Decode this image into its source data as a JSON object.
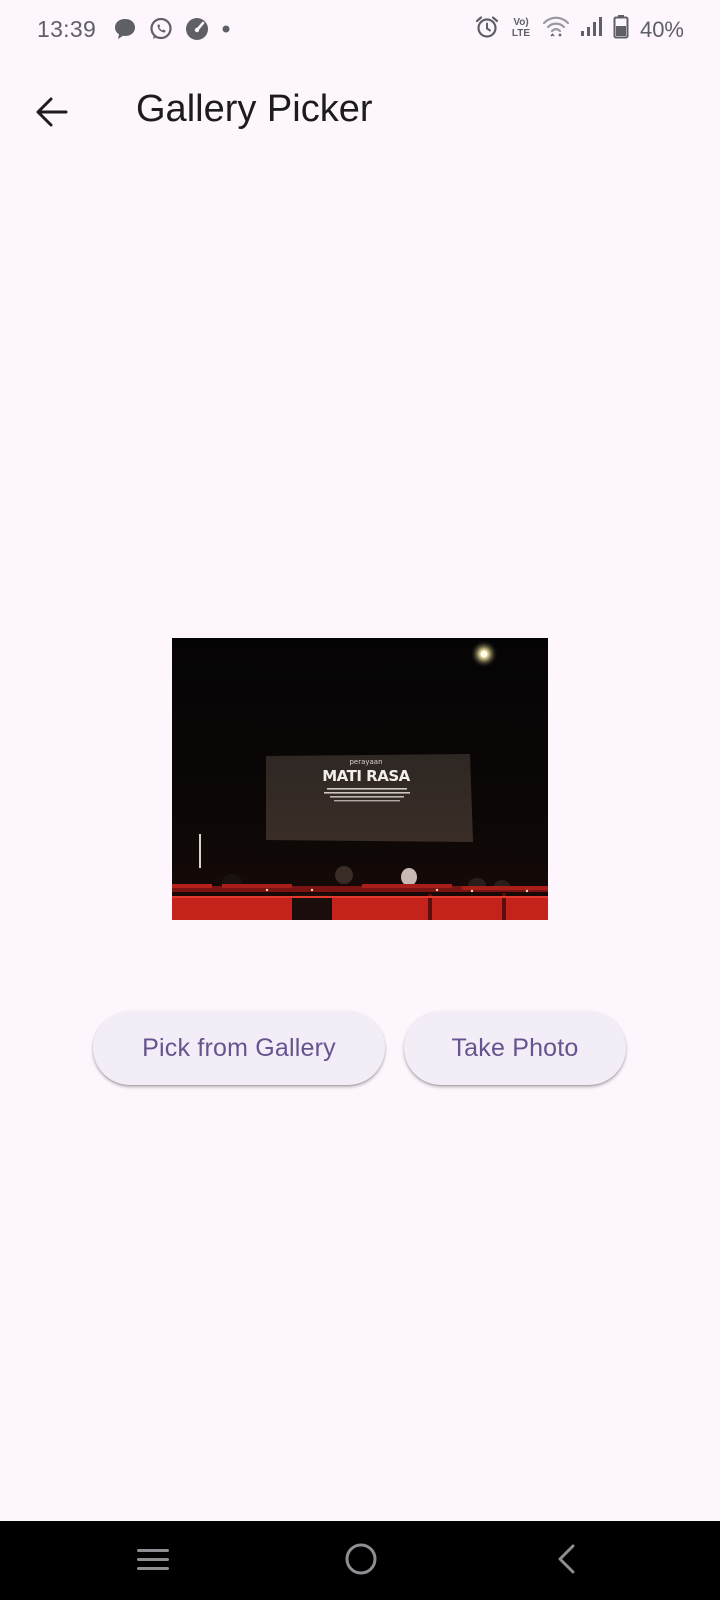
{
  "status_bar": {
    "time": "13:39",
    "battery_percent": "40%",
    "left_icons": [
      "chat-bubble-icon",
      "whatsapp-icon",
      "speedometer-icon",
      "dot-icon"
    ],
    "right_icons": [
      "alarm-icon",
      "volte-icon",
      "wifi-icon",
      "signal-icon",
      "battery-icon"
    ],
    "volte_label": "VoLTE"
  },
  "app_bar": {
    "title": "Gallery Picker",
    "back_icon": "arrow-back-icon"
  },
  "preview": {
    "screen_small_text": "perayaan",
    "screen_title": "MATI RASA"
  },
  "actions": {
    "pick_gallery_label": "Pick from Gallery",
    "take_photo_label": "Take Photo"
  },
  "navigation_bar": {
    "icons": [
      "recent-apps-icon",
      "home-icon",
      "nav-back-icon"
    ]
  },
  "colors": {
    "background": "#fdf7fd",
    "button_bg": "#f3edf7",
    "button_text": "#65558f",
    "title_text": "#1d1b20"
  }
}
